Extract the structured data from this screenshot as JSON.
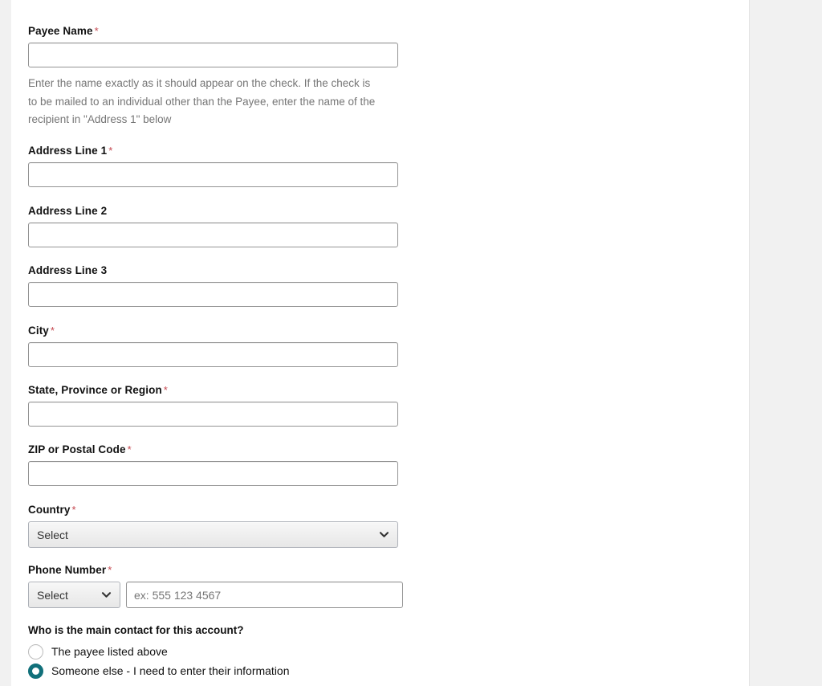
{
  "theme": {
    "page_background": "#f1f1f1",
    "panel_background": "#ffffff",
    "label_color": "#111111",
    "required_asterisk_color": "#c4464e",
    "helper_text_color": "#767676",
    "input_border_color": "#949494",
    "select_background": "#efefef",
    "radio_selected_color": "#11707a",
    "radio_unselected_border": "#bcbcbc"
  },
  "form": {
    "required_marker": "*",
    "fields": {
      "payee_name": {
        "label": "Payee Name",
        "required": true,
        "value": "",
        "placeholder": "",
        "helper_text": "Enter the name exactly as it should appear on the check. If the check is to be mailed to an individual other than the Payee, enter the name of the recipient in \"Address 1\" below"
      },
      "address_line_1": {
        "label": "Address Line 1",
        "required": true,
        "value": "",
        "placeholder": ""
      },
      "address_line_2": {
        "label": "Address Line 2",
        "required": false,
        "value": "",
        "placeholder": ""
      },
      "address_line_3": {
        "label": "Address Line 3",
        "required": false,
        "value": "",
        "placeholder": ""
      },
      "city": {
        "label": "City",
        "required": true,
        "value": "",
        "placeholder": ""
      },
      "state_province_region": {
        "label": "State, Province or Region",
        "required": true,
        "value": "",
        "placeholder": ""
      },
      "zip_postal_code": {
        "label": "ZIP or Postal Code",
        "required": true,
        "value": "",
        "placeholder": ""
      },
      "country": {
        "label": "Country",
        "required": true,
        "selected_option": "Select",
        "dropdown_icon": "chevron-down-icon"
      },
      "phone_number": {
        "label": "Phone Number",
        "required": true,
        "country_code_selected_option": "Select",
        "country_code_dropdown_icon": "chevron-down-icon",
        "number_value": "",
        "number_placeholder": "ex: 555 123 4567"
      }
    },
    "main_contact": {
      "heading": "Who is the main contact for this account?",
      "options": [
        {
          "label": "The payee listed above",
          "selected": false
        },
        {
          "label": "Someone else - I need to enter their information",
          "selected": true
        }
      ]
    }
  }
}
